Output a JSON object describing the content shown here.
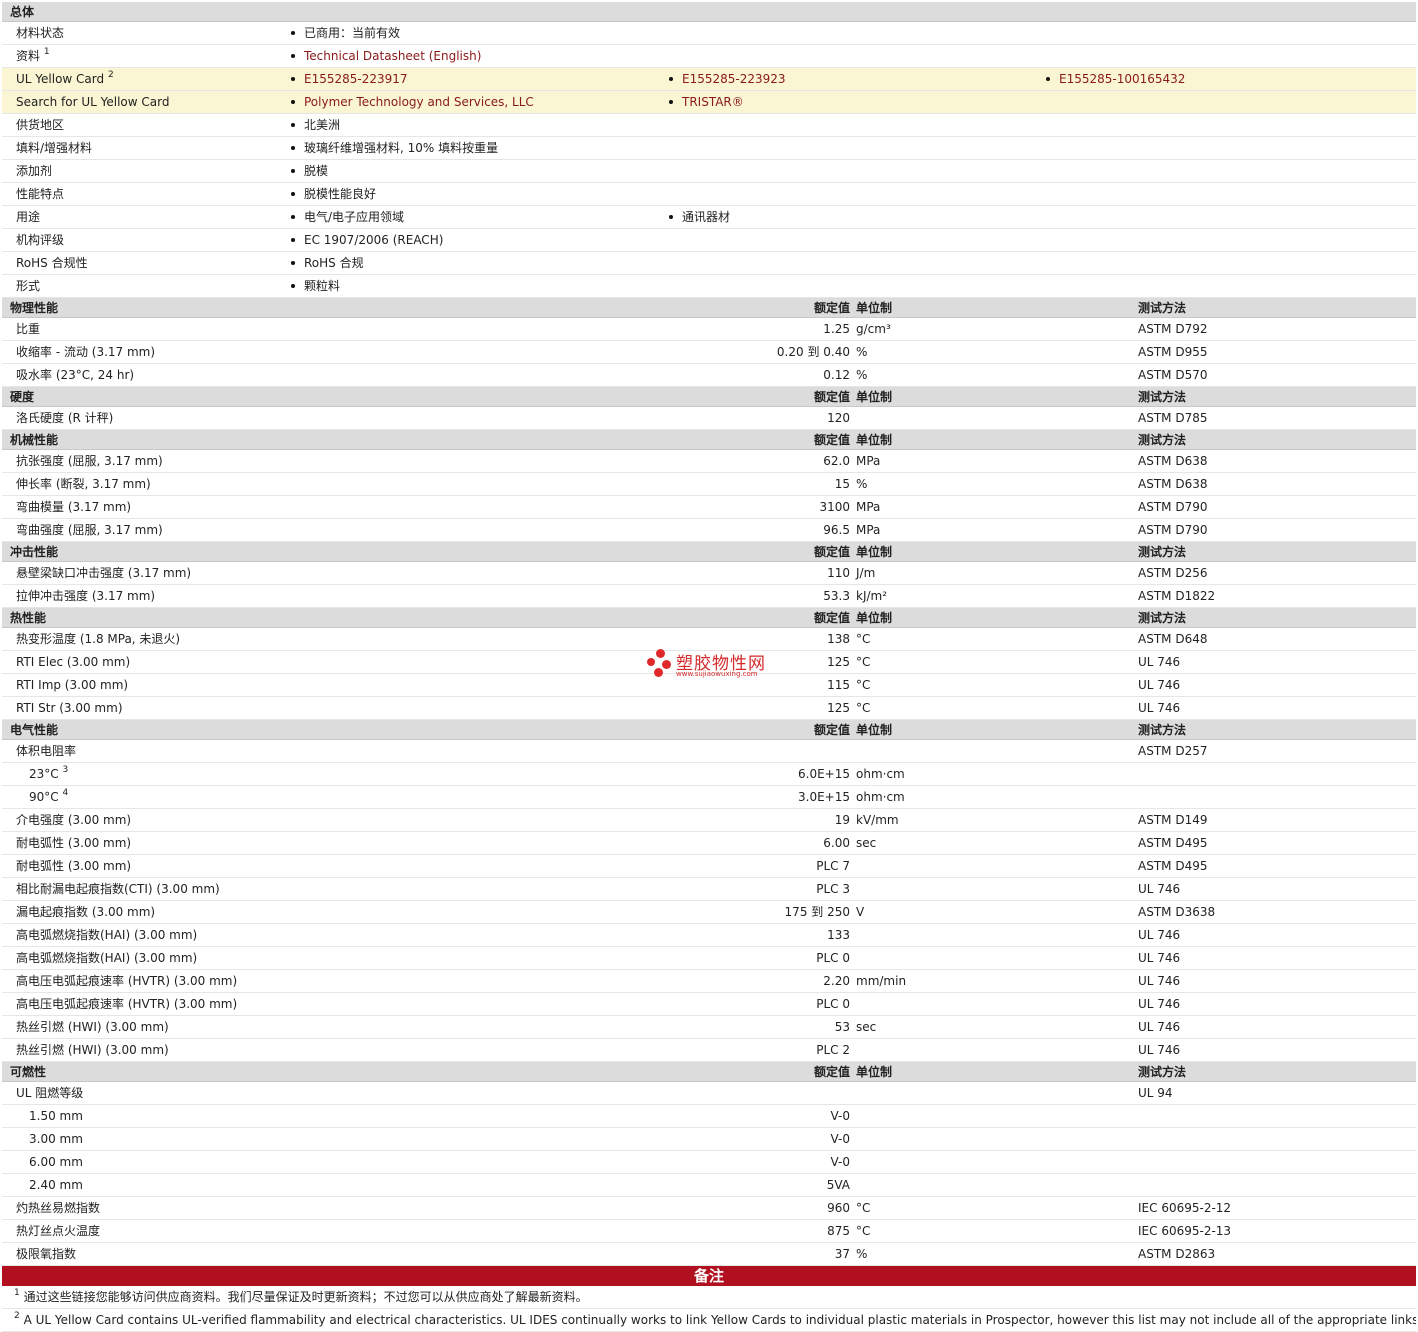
{
  "general": {
    "title": "总体",
    "rows": [
      {
        "label": "材料状态",
        "items": [
          {
            "text": "已商用：当前有效",
            "link": false
          }
        ]
      },
      {
        "label": "资料",
        "sup": "1",
        "items": [
          {
            "text": "Technical Datasheet (English)",
            "link": true
          }
        ]
      },
      {
        "label": "UL Yellow Card",
        "sup": "2",
        "highlight": true,
        "items": [
          {
            "text": "E155285-223917",
            "link": true
          },
          {
            "text": "E155285-223923",
            "link": true
          },
          {
            "text": "E155285-100165432",
            "link": true
          }
        ]
      },
      {
        "label": "Search for UL Yellow Card",
        "highlight": true,
        "items": [
          {
            "text": "Polymer Technology and Services, LLC",
            "link": true
          },
          {
            "text": "TRISTAR®",
            "link": true
          }
        ]
      },
      {
        "label": "供货地区",
        "items": [
          {
            "text": "北美洲",
            "link": false
          }
        ]
      },
      {
        "label": "填料/增强材料",
        "items": [
          {
            "text": "玻璃纤维增强材料, 10% 填料按重量",
            "link": false
          }
        ]
      },
      {
        "label": "添加剂",
        "items": [
          {
            "text": "脱模",
            "link": false
          }
        ]
      },
      {
        "label": "性能特点",
        "items": [
          {
            "text": "脱模性能良好",
            "link": false
          }
        ]
      },
      {
        "label": "用途",
        "items": [
          {
            "text": "电气/电子应用领域",
            "link": false
          },
          {
            "text": "通讯器材",
            "link": false
          }
        ]
      },
      {
        "label": "机构评级",
        "items": [
          {
            "text": "EC 1907/2006 (REACH)",
            "link": false
          }
        ]
      },
      {
        "label": "RoHS 合规性",
        "items": [
          {
            "text": "RoHS 合规",
            "link": false
          }
        ]
      },
      {
        "label": "形式",
        "items": [
          {
            "text": "颗粒料",
            "link": false
          }
        ]
      }
    ]
  },
  "col_headers": {
    "nominal": "额定值",
    "unit": "单位制",
    "method": "测试方法"
  },
  "sections": [
    {
      "title": "物理性能",
      "rows": [
        {
          "label": "比重",
          "value": "1.25",
          "unit": "g/cm³",
          "method": "ASTM D792"
        },
        {
          "label": "收缩率 - 流动 (3.17 mm)",
          "value": "0.20 到  0.40",
          "unit": "%",
          "method": "ASTM D955"
        },
        {
          "label": "吸水率 (23°C, 24 hr)",
          "value": "0.12",
          "unit": "%",
          "method": "ASTM D570"
        }
      ]
    },
    {
      "title": "硬度",
      "rows": [
        {
          "label": "洛氏硬度 (R 计秤)",
          "value": "120",
          "unit": "",
          "method": "ASTM D785"
        }
      ]
    },
    {
      "title": "机械性能",
      "rows": [
        {
          "label": "抗张强度 (屈服, 3.17 mm)",
          "value": "62.0",
          "unit": "MPa",
          "method": "ASTM D638"
        },
        {
          "label": "伸长率 (断裂, 3.17 mm)",
          "value": "15",
          "unit": "%",
          "method": "ASTM D638"
        },
        {
          "label": "弯曲模量 (3.17 mm)",
          "value": "3100",
          "unit": "MPa",
          "method": "ASTM D790"
        },
        {
          "label": "弯曲强度 (屈服, 3.17 mm)",
          "value": "96.5",
          "unit": "MPa",
          "method": "ASTM D790"
        }
      ]
    },
    {
      "title": "冲击性能",
      "rows": [
        {
          "label": "悬壁梁缺口冲击强度 (3.17 mm)",
          "value": "110",
          "unit": "J/m",
          "method": "ASTM D256"
        },
        {
          "label": "拉伸冲击强度 (3.17 mm)",
          "value": "53.3",
          "unit": "kJ/m²",
          "method": "ASTM D1822"
        }
      ]
    },
    {
      "title": "热性能",
      "rows": [
        {
          "label": "热变形温度 (1.8 MPa, 未退火)",
          "value": "138",
          "unit": "°C",
          "method": "ASTM D648"
        },
        {
          "label": "RTI Elec (3.00 mm)",
          "value": "125",
          "unit": "°C",
          "method": "UL 746"
        },
        {
          "label": "RTI Imp (3.00 mm)",
          "value": "115",
          "unit": "°C",
          "method": "UL 746"
        },
        {
          "label": "RTI Str (3.00 mm)",
          "value": "125",
          "unit": "°C",
          "method": "UL 746"
        }
      ]
    },
    {
      "title": "电气性能",
      "rows": [
        {
          "label": "体积电阻率",
          "value": "",
          "unit": "",
          "method": "ASTM D257"
        },
        {
          "label": "23°C",
          "sup": "3",
          "sub": true,
          "value": "6.0E+15",
          "unit": "ohm·cm",
          "method": ""
        },
        {
          "label": "90°C",
          "sup": "4",
          "sub": true,
          "value": "3.0E+15",
          "unit": "ohm·cm",
          "method": ""
        },
        {
          "label": "介电强度 (3.00 mm)",
          "value": "19",
          "unit": "kV/mm",
          "method": "ASTM D149"
        },
        {
          "label": "耐电弧性 (3.00 mm)",
          "value": "6.00",
          "unit": "sec",
          "method": "ASTM D495"
        },
        {
          "label": "耐电弧性 (3.00 mm)",
          "value": "PLC 7",
          "unit": "",
          "method": "ASTM D495"
        },
        {
          "label": "相比耐漏电起痕指数(CTI) (3.00 mm)",
          "value": "PLC 3",
          "unit": "",
          "method": "UL 746"
        },
        {
          "label": "漏电起痕指数 (3.00 mm)",
          "value": "175 到  250",
          "unit": "V",
          "method": "ASTM D3638"
        },
        {
          "label": "高电弧燃烧指数(HAI) (3.00 mm)",
          "value": "133",
          "unit": "",
          "method": "UL 746"
        },
        {
          "label": "高电弧燃烧指数(HAI) (3.00 mm)",
          "value": "PLC 0",
          "unit": "",
          "method": "UL 746"
        },
        {
          "label": "高电压电弧起痕速率 (HVTR) (3.00 mm)",
          "value": "2.20",
          "unit": "mm/min",
          "method": "UL 746"
        },
        {
          "label": "高电压电弧起痕速率 (HVTR) (3.00 mm)",
          "value": "PLC 0",
          "unit": "",
          "method": "UL 746"
        },
        {
          "label": "热丝引燃 (HWI) (3.00 mm)",
          "value": "53",
          "unit": "sec",
          "method": "UL 746"
        },
        {
          "label": "热丝引燃 (HWI) (3.00 mm)",
          "value": "PLC 2",
          "unit": "",
          "method": "UL 746"
        }
      ]
    },
    {
      "title": "可燃性",
      "rows": [
        {
          "label": "UL 阻燃等级",
          "value": "",
          "unit": "",
          "method": "UL 94"
        },
        {
          "label": "1.50 mm",
          "sub": true,
          "value": "V-0",
          "unit": "",
          "method": ""
        },
        {
          "label": "3.00 mm",
          "sub": true,
          "value": "V-0",
          "unit": "",
          "method": ""
        },
        {
          "label": "6.00 mm",
          "sub": true,
          "value": "V-0",
          "unit": "",
          "method": ""
        },
        {
          "label": "2.40 mm",
          "sub": true,
          "value": "5VA",
          "unit": "",
          "method": ""
        },
        {
          "label": "灼热丝易燃指数",
          "value": "960",
          "unit": "°C",
          "method": "IEC 60695-2-12"
        },
        {
          "label": "热灯丝点火温度",
          "value": "875",
          "unit": "°C",
          "method": "IEC 60695-2-13"
        },
        {
          "label": "极限氧指数",
          "value": "37",
          "unit": "%",
          "method": "ASTM D2863"
        }
      ]
    }
  ],
  "notes": {
    "title": "备注",
    "items": [
      {
        "num": "1",
        "text": "通过这些链接您能够访问供应商资料。我们尽量保证及时更新资料；不过您可以从供应商处了解最新资料。"
      },
      {
        "num": "2",
        "text": "A UL Yellow Card contains UL-verified flammability and electrical characteristics. UL IDES continually works to link Yellow Cards to individual plastic materials in Prospector, however this list may not include all of the appropriate links. It is"
      }
    ]
  },
  "watermark": {
    "text": "塑胶物性网",
    "url": "www.sujiaowuxing.com",
    "color": "#d42a2a"
  }
}
